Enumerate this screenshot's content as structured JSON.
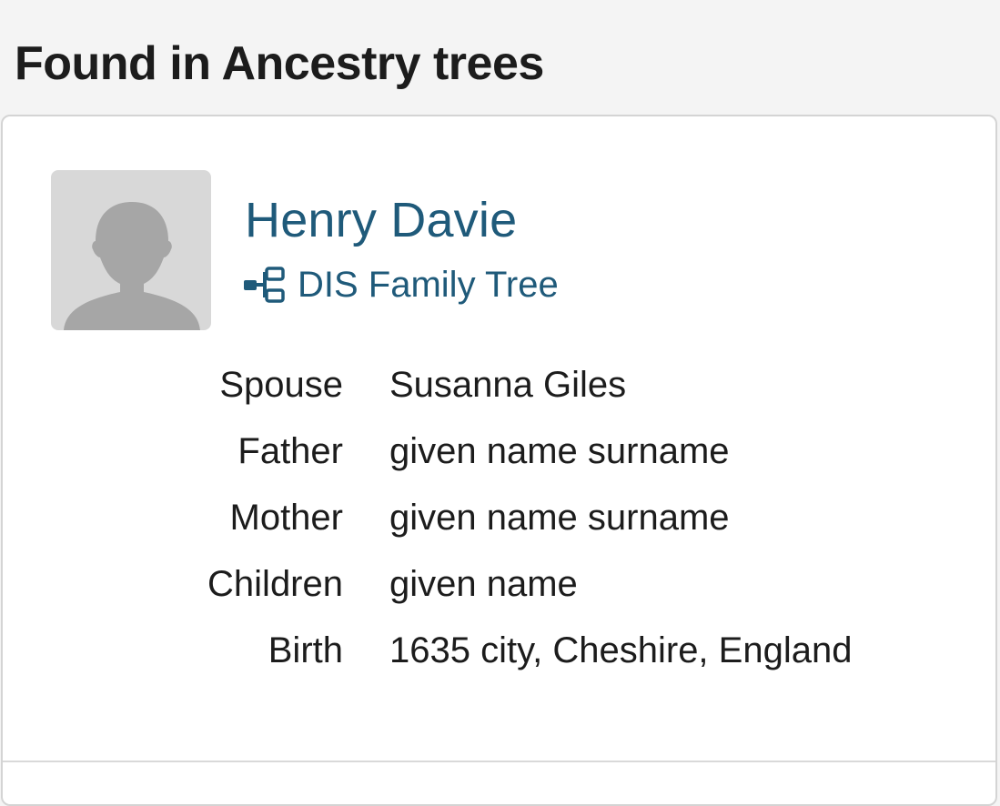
{
  "section": {
    "title": "Found in Ancestry trees"
  },
  "record": {
    "avatar_icon": "person-silhouette-icon",
    "name": "Henry Davie",
    "tree_icon": "family-tree-icon",
    "tree_name": "DIS Family Tree",
    "accent_color": "#1f5a7a",
    "facts": [
      {
        "label": "Spouse",
        "value": "Susanna Giles"
      },
      {
        "label": "Father",
        "value": "given name surname"
      },
      {
        "label": "Mother",
        "value": "given name surname"
      },
      {
        "label": "Children",
        "value": "given name"
      },
      {
        "label": "Birth",
        "value": "1635 city, Cheshire, England"
      }
    ]
  }
}
